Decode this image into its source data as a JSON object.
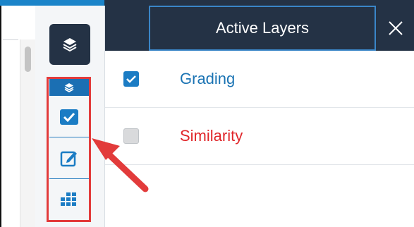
{
  "panel": {
    "title": "Active Layers",
    "close_icon": "close-icon"
  },
  "toolbar": {
    "layers_icon": "layers-icon",
    "tools": [
      {
        "icon": "checkbox-icon"
      },
      {
        "icon": "edit-icon"
      },
      {
        "icon": "grid-icon"
      }
    ]
  },
  "layers": [
    {
      "label": "Grading",
      "checked": true,
      "color": "#1a73b3"
    },
    {
      "label": "Similarity",
      "checked": false,
      "color": "#e0262a"
    }
  ],
  "colors": {
    "header": "#243245",
    "accent": "#1b7cc4",
    "highlight": "#e23b3b"
  }
}
